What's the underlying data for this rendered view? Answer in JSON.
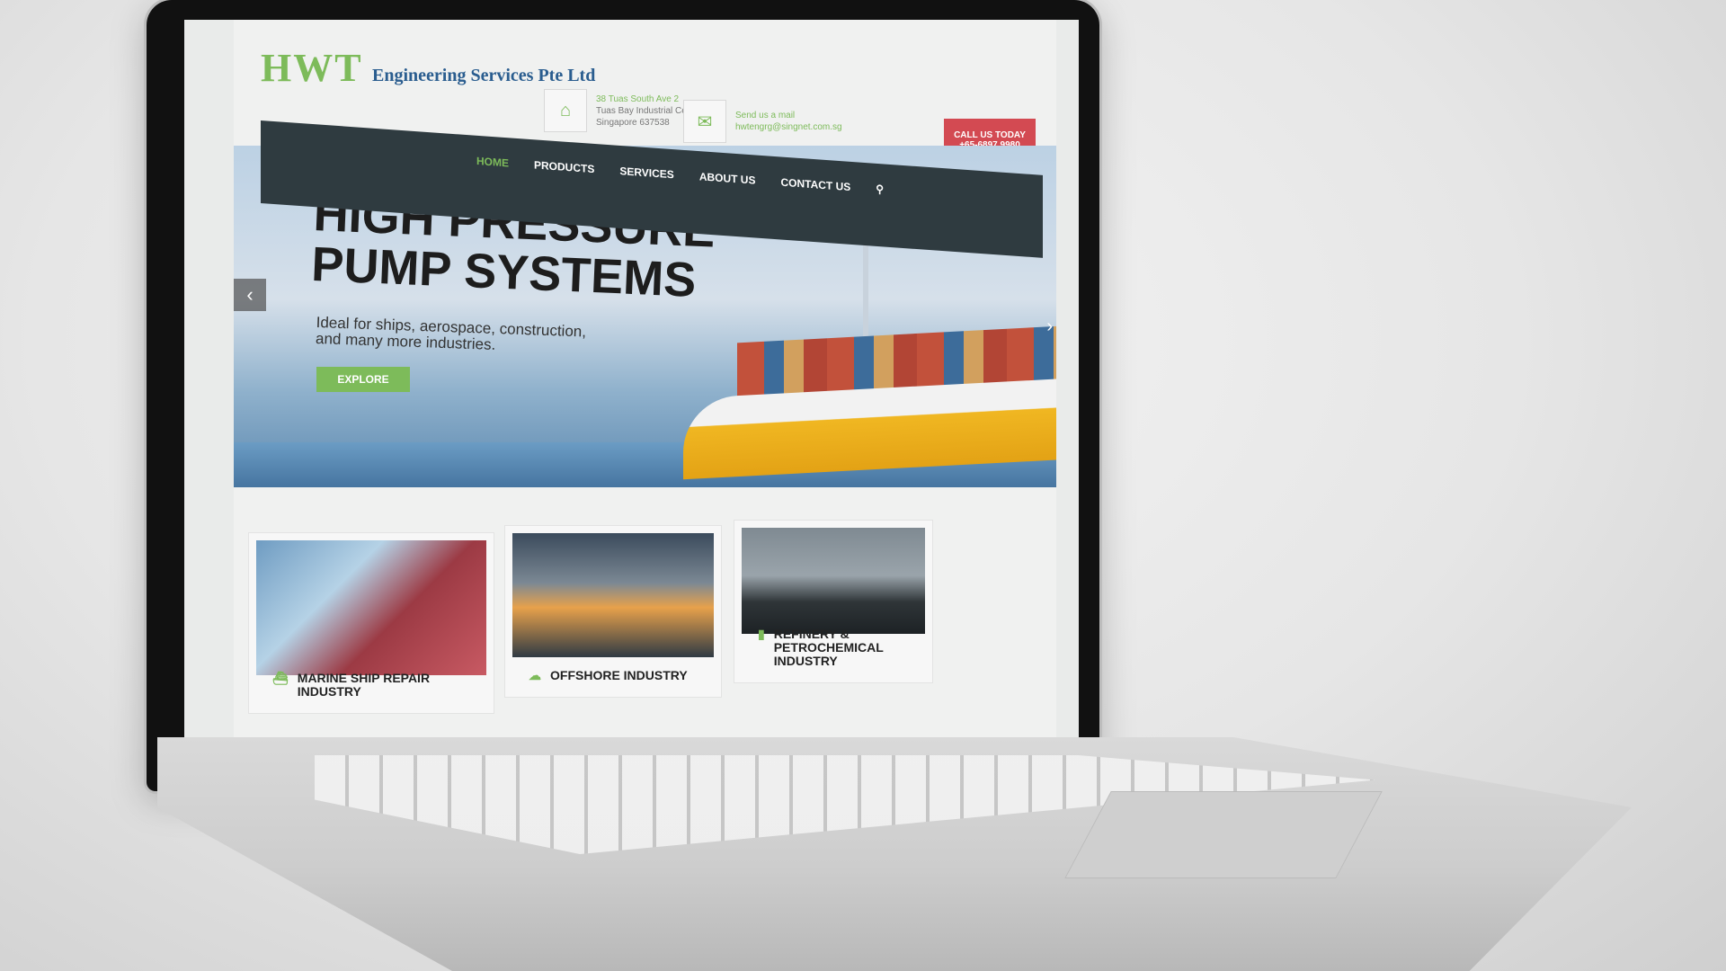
{
  "brand": {
    "initials": "HWT",
    "name": "Engineering Services Pte Ltd"
  },
  "address": {
    "line1": "38 Tuas South Ave 2",
    "line2": "Tuas Bay Industrial Centre",
    "line3": "Singapore 637538"
  },
  "mail": {
    "label": "Send us a mail",
    "email": "hwtengrg@singnet.com.sg"
  },
  "call": {
    "label": "CALL US TODAY",
    "phone": "+65-6897 9980"
  },
  "nav": {
    "items": [
      "HOME",
      "PRODUCTS",
      "SERVICES",
      "ABOUT US",
      "CONTACT US"
    ]
  },
  "hero": {
    "title_line1": "HIGH PRESSURE",
    "title_line2": "PUMP SYSTEMS",
    "subtitle_line1": "Ideal for ships, aerospace, construction,",
    "subtitle_line2": "and many more industries.",
    "button": "EXPLORE"
  },
  "cards": [
    {
      "title_line1": "MARINE SHIP REPAIR",
      "title_line2": "INDUSTRY"
    },
    {
      "title_line1": "OFFSHORE INDUSTRY",
      "title_line2": ""
    },
    {
      "title_line1": "REFINERY &",
      "title_line2": "PETROCHEMICAL INDUSTRY"
    }
  ],
  "colors": {
    "accent": "#7dbb5a",
    "nav_bg": "#2f3b40",
    "call_bg": "#d34a52",
    "brand_blue": "#2a5d8f"
  },
  "icons": {
    "address": "home-icon",
    "mail": "envelope-icon",
    "search": "search-icon",
    "card1": "ship-icon",
    "card2": "cloud-icon",
    "card3": "factory-icon"
  }
}
